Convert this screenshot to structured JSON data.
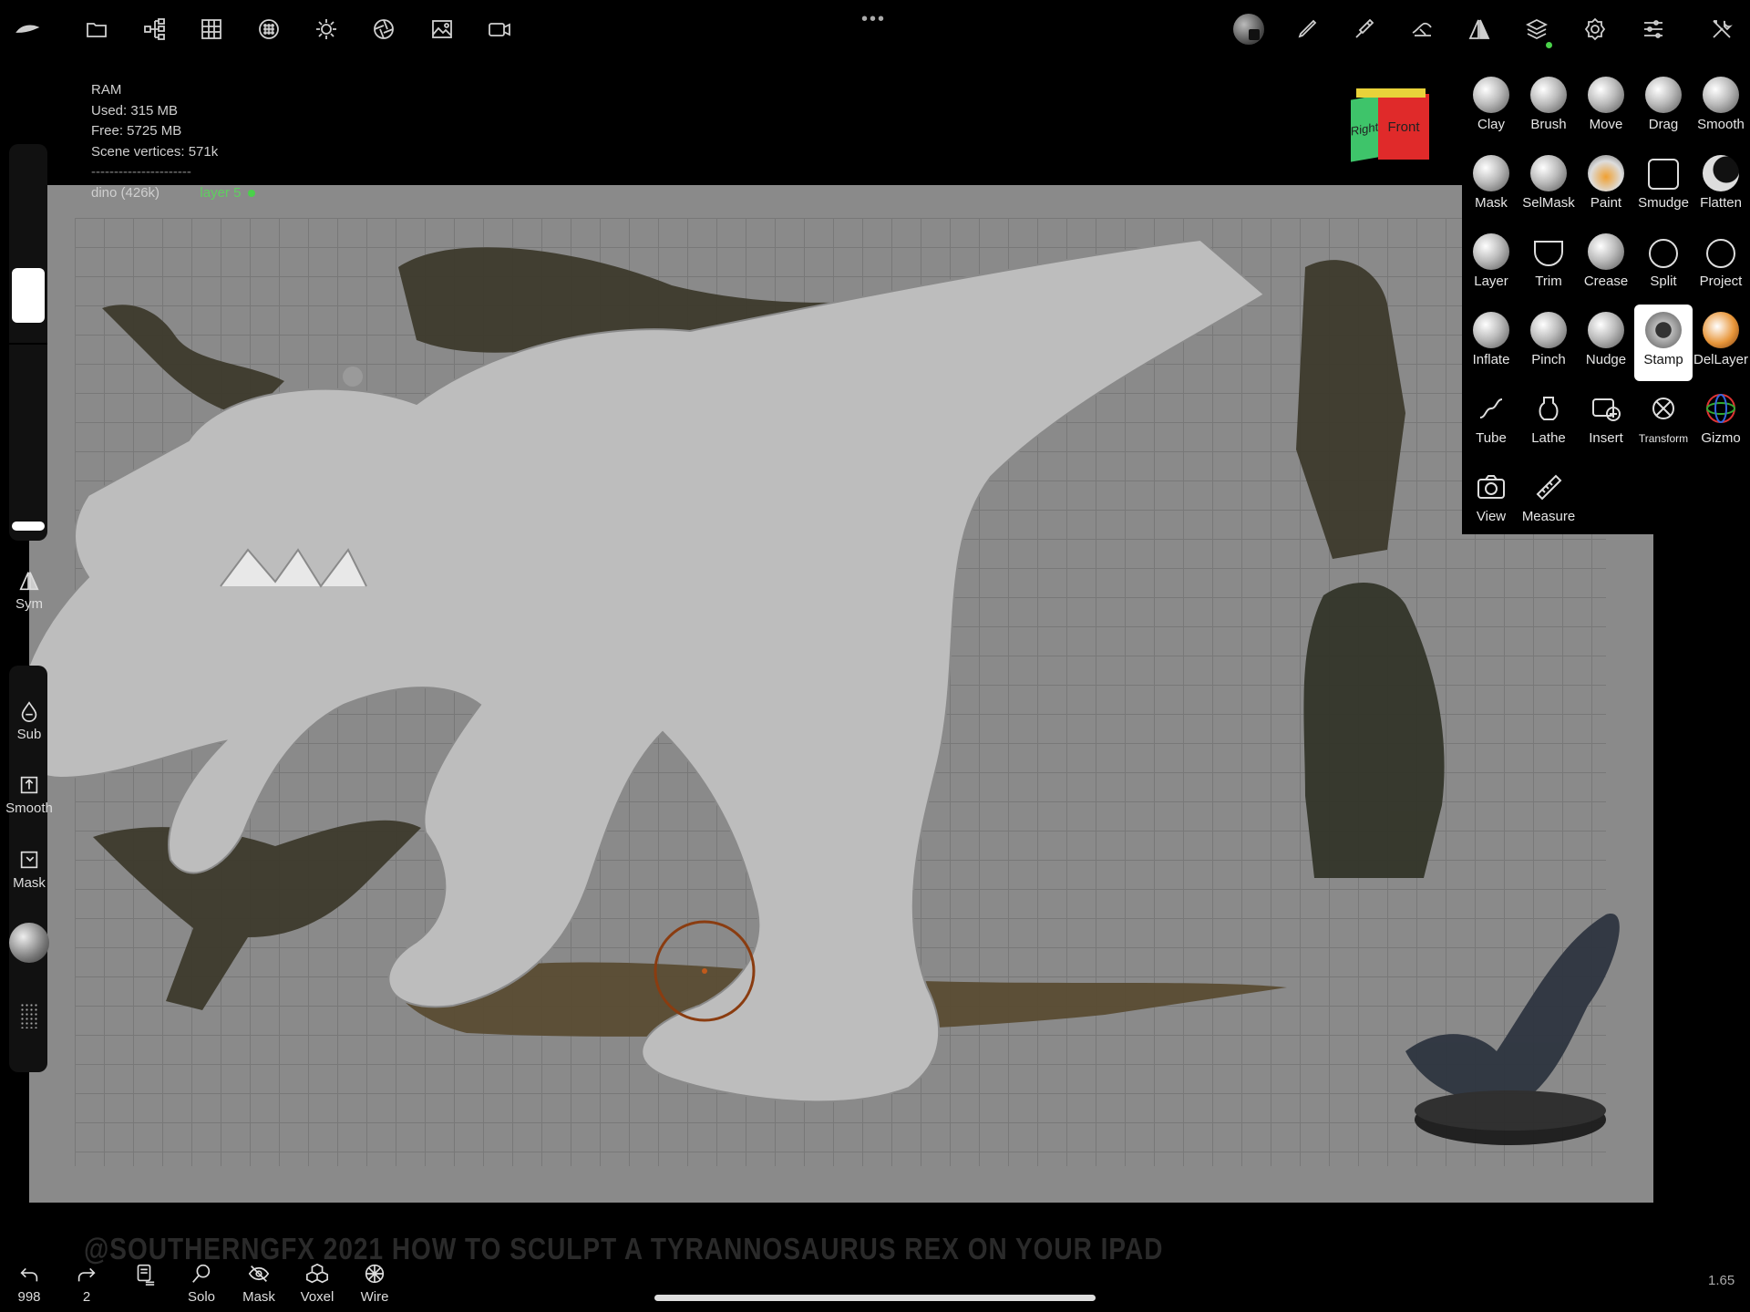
{
  "top_toolbar": {
    "icons": [
      "dolphin-logo-icon",
      "folder-icon",
      "scene-tree-icon",
      "grid-icon",
      "material-icon",
      "light-icon",
      "render-icon",
      "image-icon",
      "video-icon"
    ],
    "right_icons": [
      "material-sphere-icon",
      "brush-icon",
      "paint-icon",
      "hammer-icon",
      "symmetry-icon",
      "layers-icon",
      "settings-icon",
      "sliders-icon",
      "tools-icon"
    ]
  },
  "info": {
    "ram_label": "RAM",
    "used": "Used: 315 MB",
    "free": "Free: 5725 MB",
    "vertices": "Scene vertices: 571k",
    "separator": "----------------------",
    "mesh": "dino (426k)",
    "layer": "layer 5"
  },
  "cube": {
    "right": "Right",
    "front": "Front"
  },
  "tools": [
    {
      "label": "Clay"
    },
    {
      "label": "Brush"
    },
    {
      "label": "Move"
    },
    {
      "label": "Drag"
    },
    {
      "label": "Smooth"
    },
    {
      "label": "Mask"
    },
    {
      "label": "SelMask"
    },
    {
      "label": "Paint"
    },
    {
      "label": "Smudge"
    },
    {
      "label": "Flatten"
    },
    {
      "label": "Layer"
    },
    {
      "label": "Trim"
    },
    {
      "label": "Crease"
    },
    {
      "label": "Split"
    },
    {
      "label": "Project"
    },
    {
      "label": "Inflate"
    },
    {
      "label": "Pinch"
    },
    {
      "label": "Nudge"
    },
    {
      "label": "Stamp"
    },
    {
      "label": "DelLayer"
    },
    {
      "label": "Tube"
    },
    {
      "label": "Lathe"
    },
    {
      "label": "Insert"
    },
    {
      "label": "Transform"
    },
    {
      "label": "Gizmo"
    },
    {
      "label": "View"
    },
    {
      "label": "Measure"
    }
  ],
  "active_tool": "Stamp",
  "left_panel": {
    "sym": "Sym",
    "sub": "Sub",
    "smooth": "Smooth",
    "mask": "Mask",
    "radius_level": 0.85,
    "intensity_level": 0.0
  },
  "bottom": {
    "undo_count": "998",
    "redo_count": "2",
    "solo": "Solo",
    "mask": "Mask",
    "voxel": "Voxel",
    "wire": "Wire"
  },
  "watermark": "@SOUTHERNGFX 2021 HOW TO SCULPT A TYRANNOSAURUS REX ON YOUR IPAD",
  "zoom": "1.65",
  "colors": {
    "accent_green": "#4ad14a",
    "cursor_ring": "#8a3c10",
    "viewport_bg": "#8a8a8a"
  }
}
